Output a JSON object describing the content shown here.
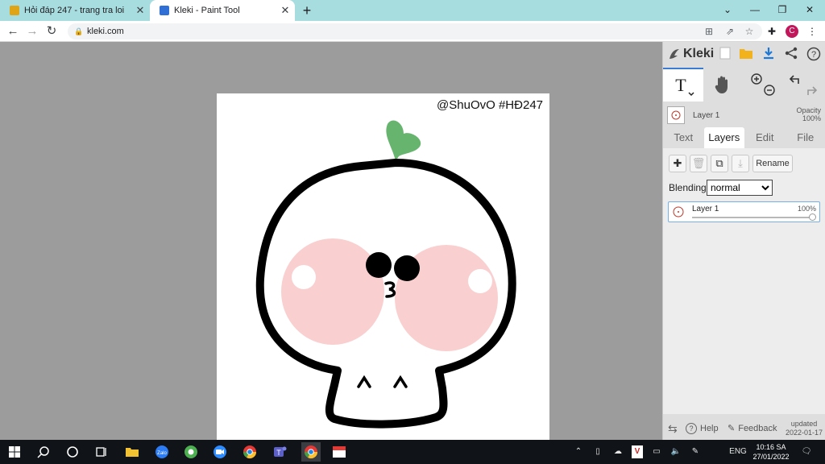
{
  "browser": {
    "tabs": [
      {
        "title": "Hỏi đáp 247 - trang tra loi",
        "active": false
      },
      {
        "title": "Kleki - Paint Tool",
        "active": true
      }
    ],
    "new_tab_label": "+",
    "address": "kleki.com"
  },
  "canvas": {
    "watermark": "@ShuOvO #HĐ247",
    "drawing_colors": {
      "outline": "#000000",
      "cheeks": "#f9cfcf",
      "sprout": "#67b46f",
      "background": "#ffffff"
    }
  },
  "panel": {
    "brand": "Kleki",
    "layer_name": "Layer 1",
    "opacity_label": "Opacity",
    "opacity_value": "100%",
    "tabs": [
      "Text",
      "Layers",
      "Edit",
      "File"
    ],
    "active_tab": "Layers",
    "rename_label": "Rename",
    "blending_label": "Blending",
    "blending_value": "normal",
    "layers": [
      {
        "name": "Layer 1",
        "opacity": "100%"
      }
    ],
    "footer": {
      "help": "Help",
      "feedback": "Feedback",
      "updated_label": "updated",
      "updated_date": "2022-01-17"
    }
  },
  "taskbar": {
    "language": "ENG",
    "time": "10:16 SA",
    "date": "27/01/2022"
  },
  "colors": {
    "tabbar": "#a8dde0",
    "accent": "#3c7bd4",
    "panel": "#dedede",
    "workspace": "#9c9c9c"
  }
}
